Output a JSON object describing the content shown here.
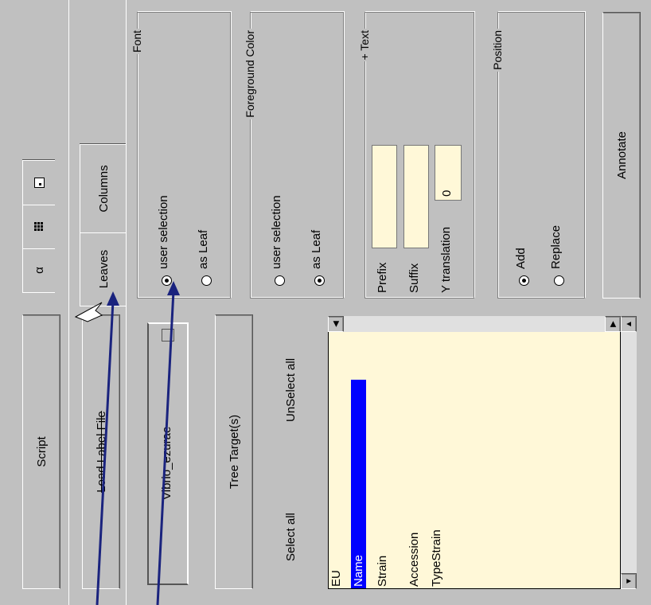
{
  "top_tabs": [
    "α",
    "grid-icon",
    "square-icon"
  ],
  "sub_tabs": {
    "leaves": "Leaves",
    "columns": "Columns"
  },
  "font_group": {
    "title": "Font",
    "options": [
      "user selection",
      "as Leaf"
    ],
    "selected": "user selection"
  },
  "fg_group": {
    "title": "Foreground Color",
    "options": [
      "user selection",
      "as Leaf"
    ],
    "selected": "as Leaf"
  },
  "text_group": {
    "title": "+ Text",
    "prefix_label": "Prefix",
    "prefix_value": "",
    "suffix_label": "Suffix",
    "suffix_value": "",
    "ytrans_label": "Y translation",
    "ytrans_value": "0"
  },
  "position_group": {
    "title": "Position",
    "options": [
      "Add",
      "Replace"
    ],
    "selected": "Add"
  },
  "annotate_button": "Annotate",
  "left": {
    "script_button": "Script",
    "load_label_button": "Load Label File",
    "tree_dropdown_value": "Vibrio_ezurae",
    "tree_target_button": "Tree Target(s)",
    "select_all": "Select all",
    "unselect_all": "UnSelect all"
  },
  "list": {
    "items": [
      "EU",
      "Name",
      "Strain",
      "Accession",
      "TypeStrain"
    ],
    "selected": "Name"
  },
  "colors": {
    "panel": "#c0c0c0",
    "list_bg": "#fff8d8",
    "selection": "#0000ff",
    "arrow": "#1a237e"
  }
}
